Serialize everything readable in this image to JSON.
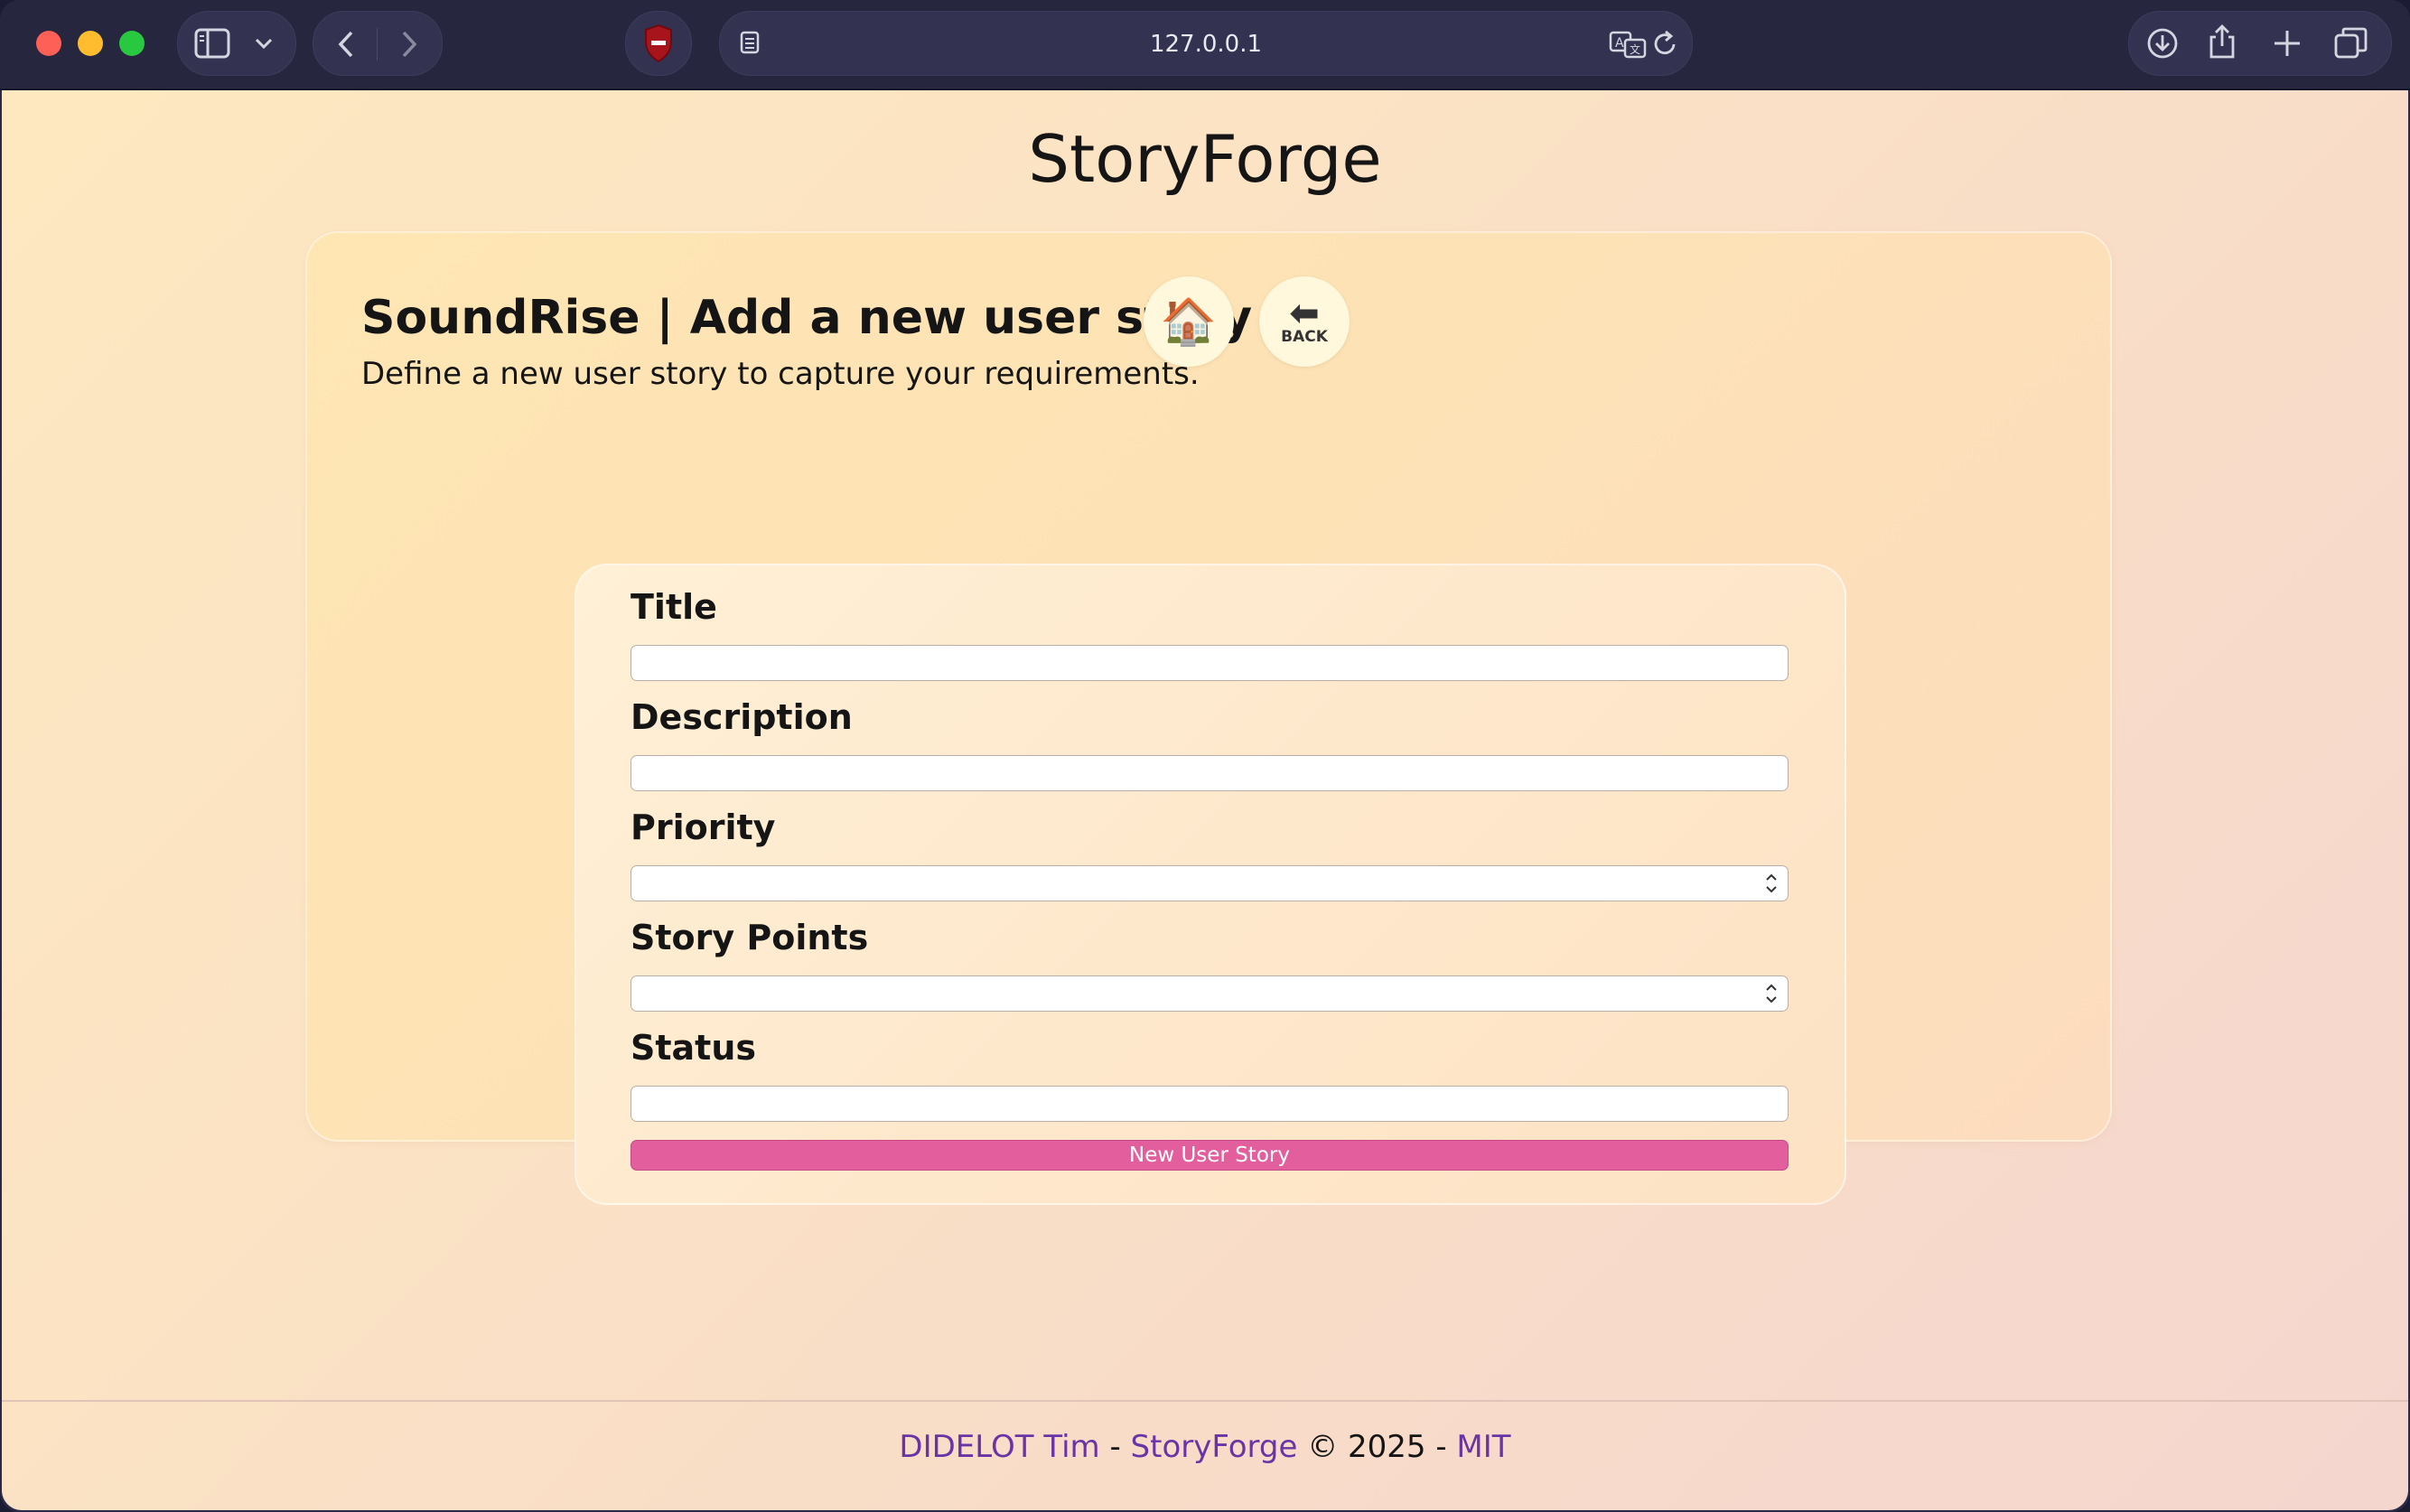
{
  "browser": {
    "url": "127.0.0.1",
    "icons": [
      "sidebar-icon",
      "chevron-down-icon",
      "back-arrow-icon",
      "forward-arrow-icon",
      "shield-icon",
      "reader-icon",
      "translate-icon",
      "reload-icon",
      "download-icon",
      "share-icon",
      "new-tab-icon",
      "tabs-overview-icon"
    ]
  },
  "site": {
    "title": "StoryForge"
  },
  "card": {
    "heading": "SoundRise | Add a new user story",
    "home_icon": "🏠",
    "back_label": "BACK",
    "description": "Define a new user story to capture your requirements."
  },
  "form": {
    "title_label": "Title",
    "title_value": "",
    "description_label": "Description",
    "description_value": "",
    "priority_label": "Priority",
    "priority_value": "",
    "story_points_label": "Story Points",
    "story_points_value": "",
    "status_label": "Status",
    "status_value": "",
    "submit_label": "New User Story"
  },
  "footer": {
    "author": "DIDELOT Tim",
    "sep1": " - ",
    "project": "StoryForge",
    "copyright": " © 2025 - ",
    "license": "MIT"
  },
  "colors": {
    "accent_button": "#e35e9d",
    "link": "#6a34a6"
  }
}
